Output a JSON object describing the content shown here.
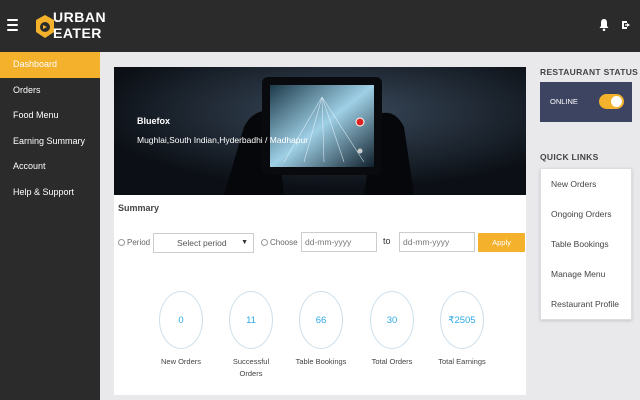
{
  "brand": {
    "line1": "URBAN",
    "line2": "EATER"
  },
  "colors": {
    "accent": "#f3b12c",
    "dark": "#2b2b2b",
    "status_panel": "#3d4462",
    "stat_value": "#2da8e6"
  },
  "sidebar": {
    "items": [
      {
        "label": "Dashboard",
        "active": true
      },
      {
        "label": "Orders"
      },
      {
        "label": "Food Menu"
      },
      {
        "label": "Earning Summary"
      },
      {
        "label": "Account"
      },
      {
        "label": "Help & Support"
      }
    ]
  },
  "restaurant": {
    "name": "Bluefox",
    "details": "Mughlai,South Indian,Hyderbadhi / Madhapur"
  },
  "summary": {
    "title": "Summary",
    "period_label": "Period",
    "period_selected": "Select period",
    "choose_label": "Choose",
    "from_placeholder": "dd-mm-yyyy",
    "to_label": "to",
    "to_placeholder": "dd-mm-yyyy",
    "apply_label": "Apply",
    "stats": [
      {
        "value": "0",
        "label": "New Orders"
      },
      {
        "value": "11",
        "label": "Successful Orders"
      },
      {
        "value": "66",
        "label": "Table Bookings"
      },
      {
        "value": "30",
        "label": "Total Orders"
      },
      {
        "value": "₹2505",
        "label": "Total Earnings"
      }
    ]
  },
  "restaurant_status": {
    "title": "RESTAURANT STATUS",
    "label": "ONLINE",
    "online": true
  },
  "quick_links": {
    "title": "QUICK LINKS",
    "items": [
      {
        "label": "New Orders"
      },
      {
        "label": "Ongoing Orders"
      },
      {
        "label": "Table Bookings"
      },
      {
        "label": "Manage Menu"
      },
      {
        "label": "Restaurant Profile"
      }
    ]
  },
  "icons": {
    "menu": "hamburger-icon",
    "notifications": "bell-icon",
    "logout": "logout-icon"
  }
}
